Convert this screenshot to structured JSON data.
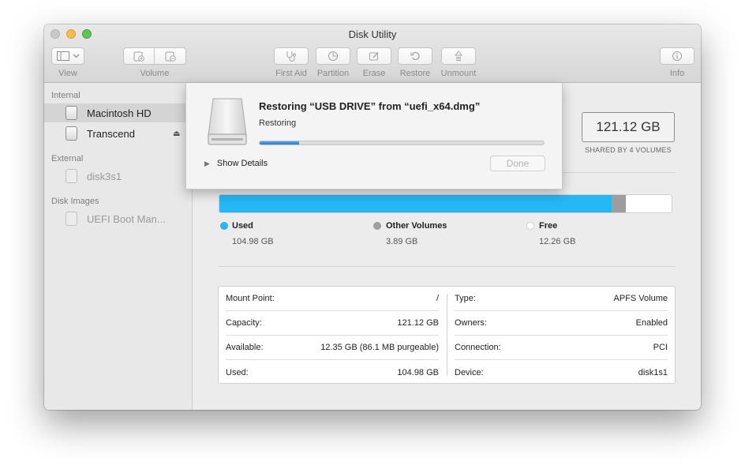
{
  "window": {
    "title": "Disk Utility"
  },
  "toolbar": {
    "view_label": "View",
    "volume_label": "Volume",
    "first_aid_label": "First Aid",
    "partition_label": "Partition",
    "erase_label": "Erase",
    "restore_label": "Restore",
    "unmount_label": "Unmount",
    "info_label": "Info"
  },
  "sidebar": {
    "sections": [
      {
        "title": "Internal",
        "items": [
          {
            "label": "Macintosh HD",
            "selected": true
          },
          {
            "label": "Transcend",
            "eject": true
          }
        ]
      },
      {
        "title": "External",
        "items": [
          {
            "label": "disk3s1"
          }
        ]
      },
      {
        "title": "Disk Images",
        "items": [
          {
            "label": "UEFI Boot Man..."
          }
        ]
      }
    ]
  },
  "summary": {
    "size": "121.12 GB",
    "size_note": "SHARED BY 4 VOLUMES"
  },
  "usage": {
    "used": {
      "name": "Used",
      "value": "104.98 GB",
      "fraction": 0.8667,
      "color": "#26b7f5"
    },
    "other": {
      "name": "Other Volumes",
      "value": "3.89 GB",
      "fraction": 0.0321,
      "color": "#9d9d9d"
    },
    "free": {
      "name": "Free",
      "value": "12.26 GB",
      "color": "#ffffff"
    }
  },
  "info": {
    "left": [
      {
        "label": "Mount Point:",
        "value": "/"
      },
      {
        "label": "Capacity:",
        "value": "121.12 GB"
      },
      {
        "label": "Available:",
        "value": "12.35 GB (86.1 MB purgeable)"
      },
      {
        "label": "Used:",
        "value": "104.98 GB"
      }
    ],
    "right": [
      {
        "label": "Type:",
        "value": "APFS Volume"
      },
      {
        "label": "Owners:",
        "value": "Enabled"
      },
      {
        "label": "Connection:",
        "value": "PCI"
      },
      {
        "label": "Device:",
        "value": "disk1s1"
      }
    ]
  },
  "sheet": {
    "title": "Restoring “USB DRIVE” from “uefi_x64.dmg”",
    "status": "Restoring",
    "progress": 0.14,
    "details_label": "Show Details",
    "done_label": "Done"
  }
}
